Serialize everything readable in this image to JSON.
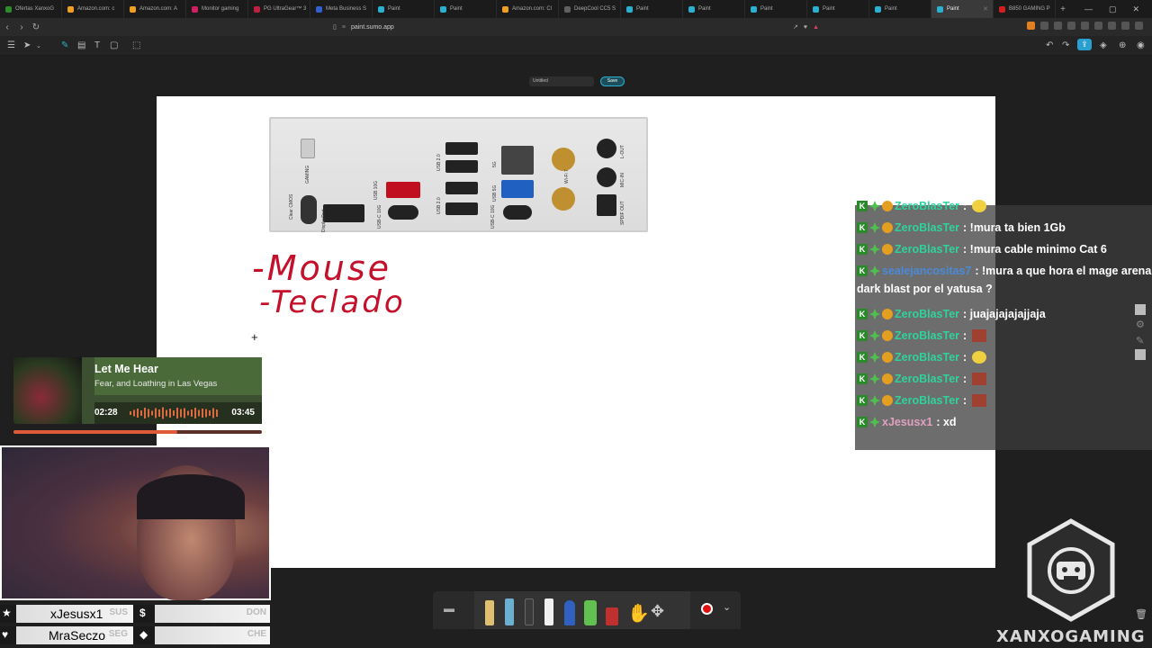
{
  "browser": {
    "tabs": [
      {
        "label": "Ofertas XanxoG",
        "color": "#2d8a2d"
      },
      {
        "label": "Amazon.com: c",
        "color": "#f0a020"
      },
      {
        "label": "Amazon.com: A",
        "color": "#f0a020"
      },
      {
        "label": "Monitor gaming",
        "color": "#d02060"
      },
      {
        "label": "PG UltraGear™ 3",
        "color": "#c02040"
      },
      {
        "label": "Meta Business S",
        "color": "#3060d0"
      },
      {
        "label": "Paint",
        "color": "#2ab0d0"
      },
      {
        "label": "Paint",
        "color": "#2ab0d0"
      },
      {
        "label": "Amazon.com: Cl",
        "color": "#f0a020"
      },
      {
        "label": "DeepCool CC5 S",
        "color": "#606060"
      },
      {
        "label": "Paint",
        "color": "#2ab0d0"
      },
      {
        "label": "Paint",
        "color": "#2ab0d0"
      },
      {
        "label": "Paint",
        "color": "#2ab0d0"
      },
      {
        "label": "Paint",
        "color": "#2ab0d0"
      },
      {
        "label": "Paint",
        "color": "#2ab0d0"
      },
      {
        "label": "Paint",
        "color": "#2ab0d0",
        "active": true
      },
      {
        "label": "B850 GAMING P",
        "color": "#d02020"
      }
    ],
    "address": "paint.sumo.app"
  },
  "app": {
    "document_name": "Untitled",
    "save_label": "Save"
  },
  "panel_labels": {
    "gaming": "GAMING",
    "usb20_a": "USB 2.0",
    "usb20_b": "USB 2.0",
    "usb10g": "USB 10G",
    "usbc10g_a": "USB-C 10G",
    "usbc10g_b": "USB-C 10G",
    "usb5g": "USB 5G",
    "g5": "5G",
    "displayport": "DisplayPort",
    "wifi": "Wi-Fi 7",
    "lout": "L-OUT",
    "micin": "MIC-IN",
    "spdif": "SPDIF OUT",
    "clrcmos": "Clear CMOS"
  },
  "handwriting": {
    "line1": "-Mouse",
    "line2": "-Teclado"
  },
  "music": {
    "title": "Let Me Hear",
    "artist": "Fear, and Loathing in Las Vegas",
    "elapsed": "02:28",
    "duration": "03:45",
    "progress_fraction": 0.66
  },
  "chat": {
    "messages": [
      {
        "user": "ZeroBlasTer",
        "text": ":",
        "emote": "pacman"
      },
      {
        "user": "ZeroBlasTer",
        "text": ": !mura ta bien 1Gb"
      },
      {
        "user": "ZeroBlasTer",
        "text": ": !mura cable minimo Cat 6"
      },
      {
        "user": "sealejancositas7",
        "text": ": !mura a que hora el mage arena",
        "text2": "dark blast por el yatusa ?"
      },
      {
        "user": "ZeroBlasTer",
        "text": ": juajajajajajjaja"
      },
      {
        "user": "ZeroBlasTer",
        "text": ":",
        "emote": "face"
      },
      {
        "user": "ZeroBlasTer",
        "text": ":",
        "emote": "pacman"
      },
      {
        "user": "ZeroBlasTer",
        "text": ":",
        "emote": "face"
      },
      {
        "user": "ZeroBlasTer",
        "text": ":",
        "emote": "face"
      },
      {
        "user": "xJesusx1",
        "text": ": xd"
      }
    ]
  },
  "overlay": {
    "row1_name": "xJesusx1",
    "row1_tag": "SUS",
    "row1_right_tag": "DON",
    "row2_name": "MraSeczo",
    "row2_tag": "SEG",
    "row2_right_tag": "CHE"
  },
  "brand": "XANXOGAMING"
}
